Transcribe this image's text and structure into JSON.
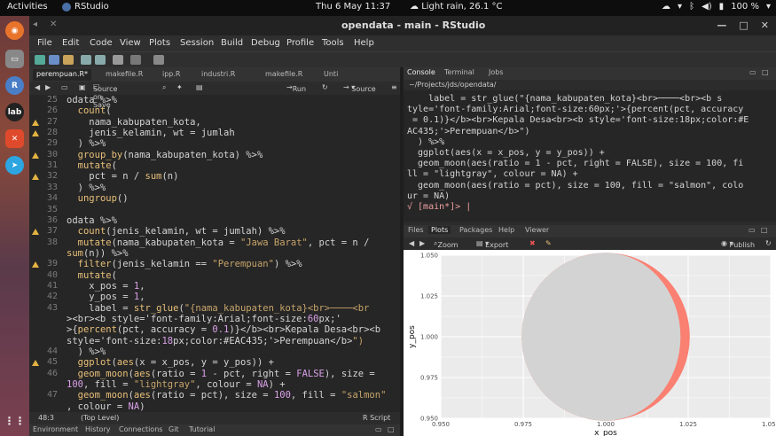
{
  "topbar": {
    "activities": "Activities",
    "app": "RStudio",
    "clock": "Thu 6 May  11:37",
    "weather": "Light rain, 26.1 °C",
    "battery": "100 %"
  },
  "window": {
    "title": "opendata - main - RStudio"
  },
  "menu": [
    "File",
    "Edit",
    "Code",
    "View",
    "Plots",
    "Session",
    "Build",
    "Debug",
    "Profile",
    "Tools",
    "Help"
  ],
  "editor": {
    "tabs": [
      "perempuan.R*",
      "makefile.R",
      "ipp.R",
      "industri.R",
      "makefile.R",
      "Unti"
    ],
    "source_on_save": "Source on Save",
    "run": "Run",
    "source": "Source",
    "position": "48:3",
    "scope": "(Top Level)",
    "filetype": "R Script"
  },
  "code_lines": [
    {
      "n": "25",
      "warn": false,
      "t": "odata %>%"
    },
    {
      "n": "26",
      "warn": false,
      "t": "  count("
    },
    {
      "n": "27",
      "warn": true,
      "t": "    nama_kabupaten_kota,"
    },
    {
      "n": "28",
      "warn": true,
      "t": "    jenis_kelamin, wt = jumlah"
    },
    {
      "n": "29",
      "warn": false,
      "t": "  ) %>%"
    },
    {
      "n": "30",
      "warn": true,
      "t": "  group_by(nama_kabupaten_kota) %>%"
    },
    {
      "n": "31",
      "warn": false,
      "t": "  mutate("
    },
    {
      "n": "32",
      "warn": true,
      "t": "    pct = n / sum(n)"
    },
    {
      "n": "33",
      "warn": false,
      "t": "  ) %>%"
    },
    {
      "n": "34",
      "warn": false,
      "t": "  ungroup()"
    },
    {
      "n": "35",
      "warn": false,
      "t": ""
    },
    {
      "n": "36",
      "warn": false,
      "t": "odata %>%"
    },
    {
      "n": "37",
      "warn": true,
      "t": "  count(jenis_kelamin, wt = jumlah) %>%"
    },
    {
      "n": "38",
      "warn": false,
      "t": "  mutate(nama_kabupaten_kota = \"Jawa Barat\", pct = n /"
    },
    {
      "n": "",
      "warn": false,
      "t": "sum(n)) %>%"
    },
    {
      "n": "39",
      "warn": true,
      "t": "  filter(jenis_kelamin == \"Perempuan\") %>%"
    },
    {
      "n": "40",
      "warn": false,
      "t": "  mutate("
    },
    {
      "n": "41",
      "warn": false,
      "t": "    x_pos = 1,"
    },
    {
      "n": "42",
      "warn": false,
      "t": "    y_pos = 1,"
    },
    {
      "n": "43",
      "warn": false,
      "t": "    label = str_glue(\"{nama_kabupaten_kota}<br>────<br"
    },
    {
      "n": "",
      "warn": false,
      "t": "><br><b style='font-family:Arial;font-size:60px;'"
    },
    {
      "n": "",
      "warn": false,
      "t": ">{percent(pct, accuracy = 0.1)}</b><br>Kepala Desa<br><b"
    },
    {
      "n": "",
      "warn": false,
      "t": "style='font-size:18px;color:#EAC435;'>Perempuan</b>\")"
    },
    {
      "n": "44",
      "warn": false,
      "t": "  ) %>%"
    },
    {
      "n": "45",
      "warn": true,
      "t": "  ggplot(aes(x = x_pos, y = y_pos)) +"
    },
    {
      "n": "46",
      "warn": false,
      "t": "  geom_moon(aes(ratio = 1 - pct, right = FALSE), size ="
    },
    {
      "n": "",
      "warn": false,
      "t": "100, fill = \"lightgray\", colour = NA) +"
    },
    {
      "n": "47",
      "warn": false,
      "t": "  geom_moon(aes(ratio = pct), size = 100, fill = \"salmon\""
    },
    {
      "n": "",
      "warn": false,
      "t": ", colour = NA)"
    }
  ],
  "console": {
    "tabs": [
      "Console",
      "Terminal",
      "Jobs"
    ],
    "path": "~/Projects/jds/opendata/",
    "lines": [
      "    label = str_glue(\"{nama_kabupaten_kota}<br>────<br><b s",
      "tyle='font-family:Arial;font-size:60px;'>{percent(pct, accuracy",
      " = 0.1)}</b><br>Kepala Desa<br><b style='font-size:18px;color:#E",
      "AC435;'>Perempuan</b>\")",
      "  ) %>%",
      "  ggplot(aes(x = x_pos, y = y_pos)) +",
      "  geom_moon(aes(ratio = 1 - pct, right = FALSE), size = 100, fi",
      "ll = \"lightgray\", colour = NA) +",
      "  geom_moon(aes(ratio = pct), size = 100, fill = \"salmon\", colo",
      "ur = NA)"
    ],
    "prompt": "√ [main*]> "
  },
  "plots": {
    "tabs": [
      "Files",
      "Plots",
      "Packages",
      "Help",
      "Viewer"
    ],
    "zoom": "Zoom",
    "export": "Export",
    "publish": "Publish"
  },
  "chart_data": {
    "type": "scatter",
    "xlabel": "x_pos",
    "ylabel": "y_pos",
    "xlim": [
      0.95,
      1.05
    ],
    "ylim": [
      0.95,
      1.05
    ],
    "x_ticks": [
      "0.950",
      "0.975",
      "1.000",
      "1.025",
      "1.050"
    ],
    "y_ticks": [
      "0.950",
      "0.975",
      "1.000",
      "1.025",
      "1.050"
    ],
    "x_tick_values": [
      0.95,
      0.975,
      1.0,
      1.025,
      1.05
    ],
    "y_tick_values": [
      0.95,
      0.975,
      1.0,
      1.025,
      1.05
    ],
    "grid": true,
    "point": {
      "x": 1,
      "y": 1
    },
    "moon_ratio": 0.055,
    "fill_back": "#d3d3d3",
    "fill_front": "#fa8072",
    "panel_bg": "#ebebeb",
    "grid_color": "#ffffff"
  }
}
